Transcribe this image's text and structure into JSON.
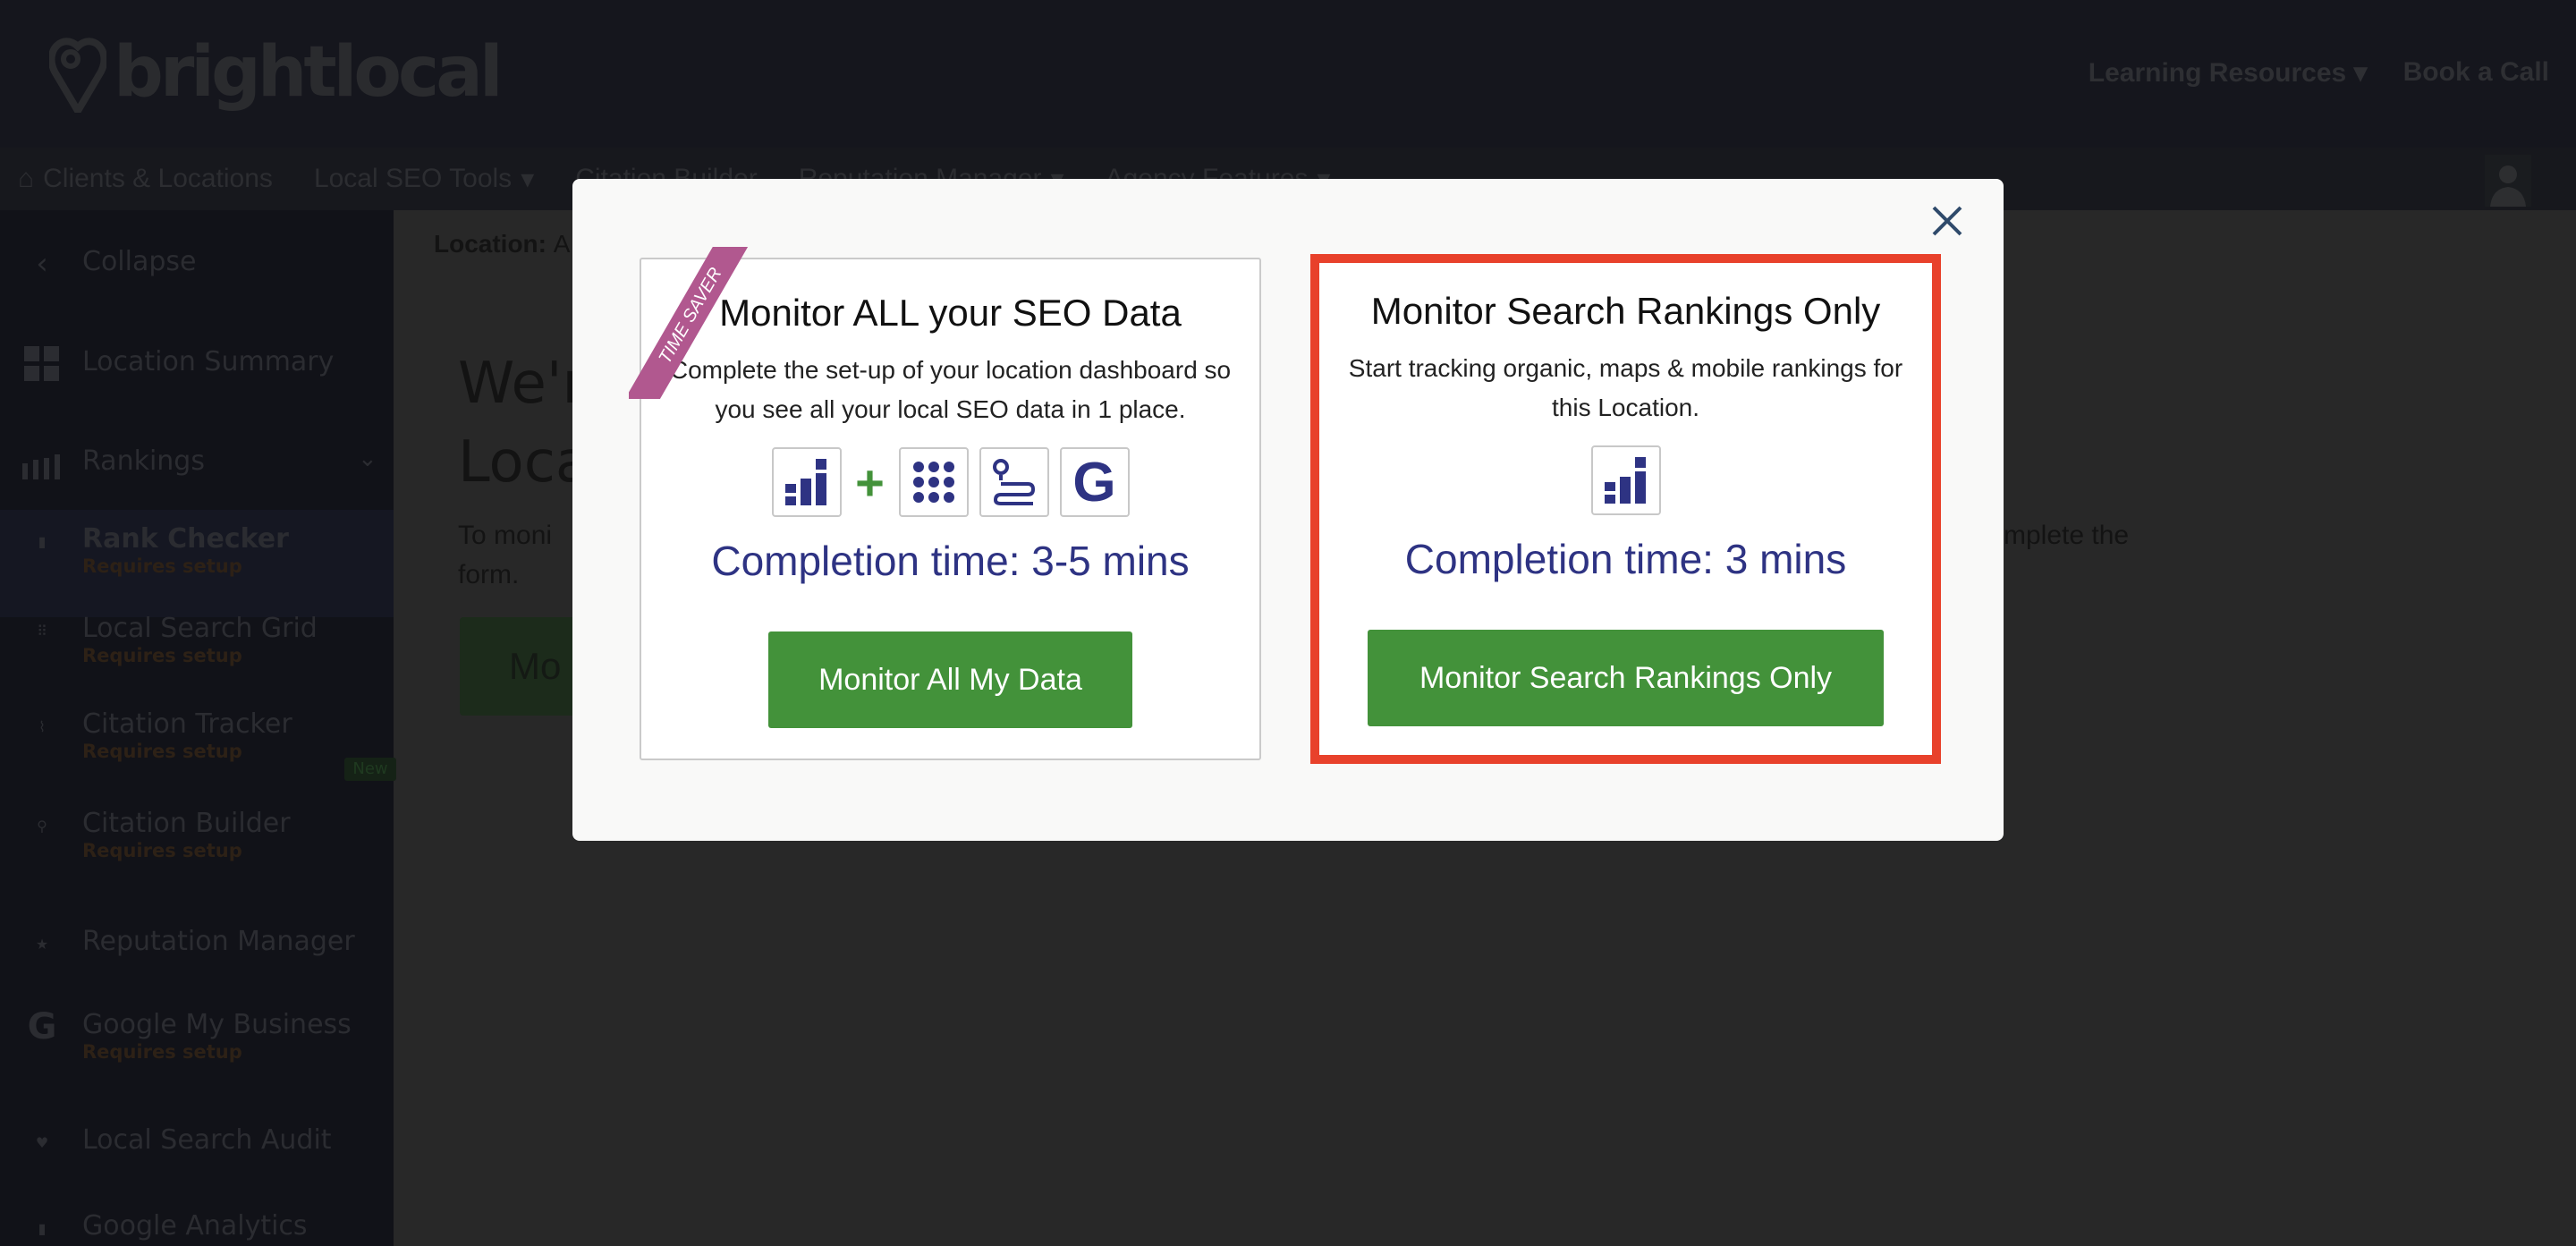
{
  "header": {
    "logo": "brightlocal",
    "links": [
      "Learning Resources",
      "Book a Call"
    ]
  },
  "nav": {
    "items": [
      "Clients & Locations",
      "Local SEO Tools",
      "Citation Builder",
      "Reputation Manager",
      "Agency Features"
    ]
  },
  "sidebar": {
    "collapse": "Collapse",
    "items": [
      {
        "label": "Location Summary",
        "icon": "grid-icon"
      },
      {
        "label": "Rankings",
        "icon": "rankings-icon"
      },
      {
        "label": "Rank Checker",
        "sub": "Requires setup",
        "icon": "bar-chart-icon"
      },
      {
        "label": "Local Search Grid",
        "sub": "Requires setup",
        "icon": "dots-grid-icon",
        "badge": "New"
      },
      {
        "label": "Citation Tracker",
        "sub": "Requires setup",
        "icon": "route-icon"
      },
      {
        "label": "Citation Builder",
        "sub": "Requires setup",
        "icon": "pins-icon"
      },
      {
        "label": "Reputation Manager",
        "icon": "star-review-icon"
      },
      {
        "label": "Google My Business",
        "sub": "Requires setup",
        "icon": "google-icon"
      },
      {
        "label": "Local Search Audit",
        "icon": "audit-icon"
      },
      {
        "label": "Google Analytics",
        "icon": "analytics-icon"
      }
    ]
  },
  "main": {
    "location_label": "Location:",
    "location_value": "A",
    "heading_line1": "We'r",
    "heading_line2": "Loca",
    "body_line1_start": "To moni",
    "body_line1_end": "mplete the",
    "body_line2": "form.",
    "button": "Mo"
  },
  "modal": {
    "left": {
      "ribbon": "TIME SAVER",
      "title": "Monitor ALL your SEO Data",
      "desc": "Complete the set-up of your location dashboard so you see all your local SEO data in 1 place.",
      "completion": "Completion time: 3-5 mins",
      "button": "Monitor All My Data"
    },
    "right": {
      "title": "Monitor Search Rankings Only",
      "desc": "Start tracking organic, maps & mobile rankings for this Location.",
      "completion": "Completion time: 3 mins",
      "button": "Monitor Search Rankings Only"
    }
  },
  "colors": {
    "accent_green": "#43923a",
    "completion_blue": "#2e3383",
    "highlight_red": "#e8412b",
    "ribbon": "#b1588f"
  }
}
